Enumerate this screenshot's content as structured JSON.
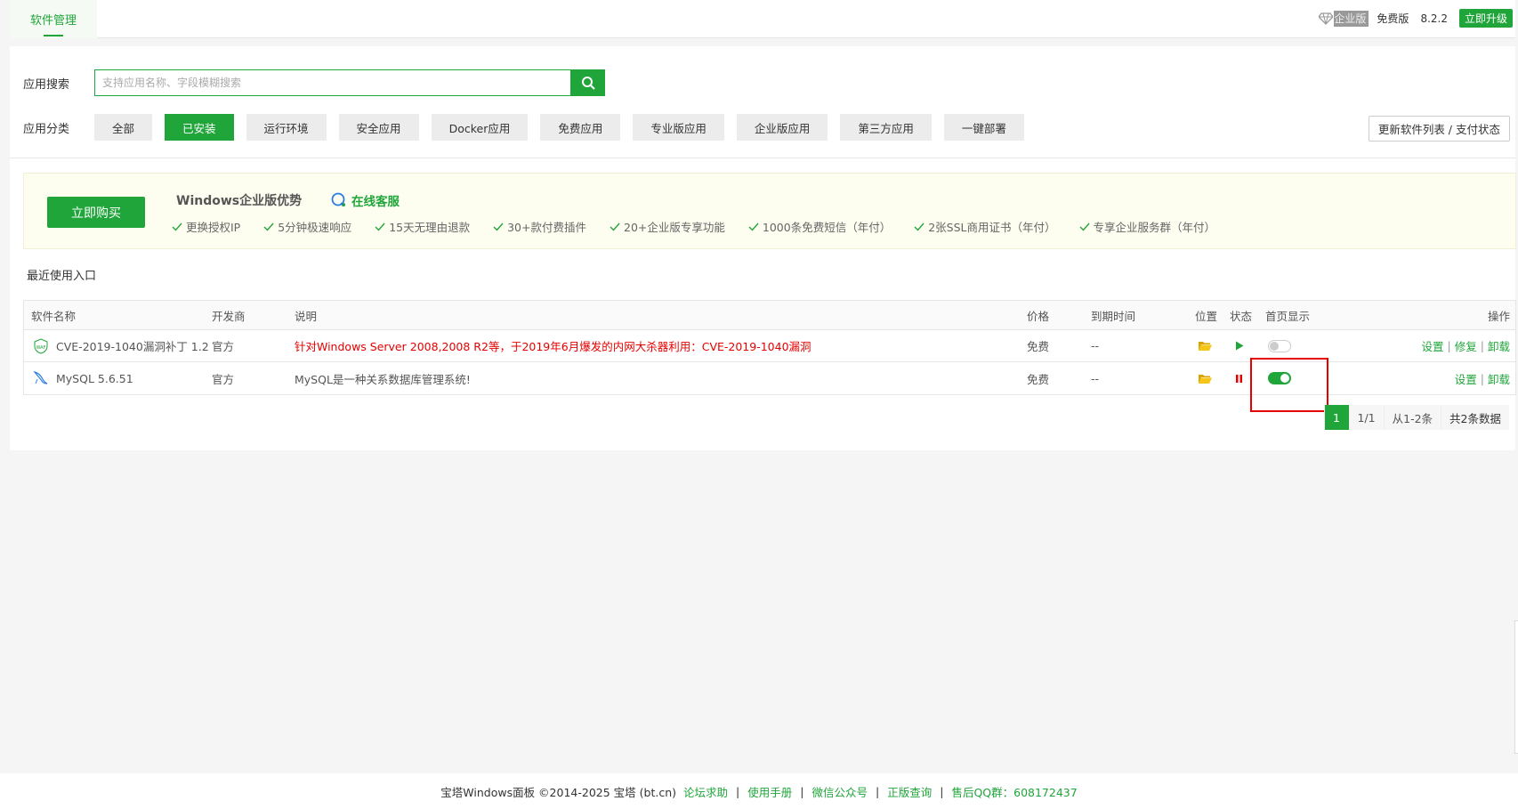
{
  "topbar": {
    "tab": "软件管理",
    "enterprise_label": "企业版",
    "free_label": "免费版",
    "version": "8.2.2",
    "upgrade": "立即升级"
  },
  "search": {
    "label": "应用搜索",
    "placeholder": "支持应用名称、字段模糊搜索"
  },
  "categories": {
    "label": "应用分类",
    "items": [
      "全部",
      "已安装",
      "运行环境",
      "安全应用",
      "Docker应用",
      "免费应用",
      "专业版应用",
      "企业版应用",
      "第三方应用",
      "一键部署"
    ],
    "active_index": 1,
    "refresh": "更新软件列表 / 支付状态"
  },
  "promo": {
    "buy": "立即购买",
    "title": "Windows企业版优势",
    "service": "在线客服",
    "features": [
      "更换授权IP",
      "5分钟极速响应",
      "15天无理由退款",
      "30+款付费插件",
      "20+企业版专享功能",
      "1000条免费短信（年付）",
      "2张SSL商用证书（年付）",
      "专享企业服务群（年付）"
    ]
  },
  "recent_label": "最近使用入口",
  "table": {
    "headers": {
      "name": "软件名称",
      "developer": "开发商",
      "desc": "说明",
      "price": "价格",
      "expire": "到期时间",
      "location": "位置",
      "status": "状态",
      "homepage": "首页显示",
      "ops": "操作"
    },
    "rows": [
      {
        "name": "CVE-2019-1040漏洞补丁 1.2",
        "developer": "官方",
        "desc": "针对Windows Server 2008,2008 R2等，于2019年6月爆发的内网大杀器利用：CVE-2019-1040漏洞",
        "price": "免费",
        "expire": "--",
        "status": "stopped",
        "homepage": false,
        "op_settings": "设置",
        "op_repair": "修复",
        "op_uninstall": "卸载"
      },
      {
        "name": "MySQL 5.6.51",
        "developer": "官方",
        "desc": "MySQL是一种关系数据库管理系统!",
        "price": "免费",
        "expire": "--",
        "status": "running",
        "homepage": true,
        "op_settings": "设置",
        "op_uninstall": "卸载"
      }
    ]
  },
  "pagination": {
    "current": "1",
    "pages": "1/1",
    "range": "从1-2条",
    "total": "共2条数据"
  },
  "footer": {
    "copyright": "宝塔Windows面板 ©2014-2025 宝塔 (bt.cn)",
    "links": [
      "论坛求助",
      "使用手册",
      "微信公众号",
      "正版查询",
      "售后QQ群：608172437"
    ]
  },
  "colors": {
    "accent": "#20a53a",
    "danger": "#e60000",
    "folder": "#f5b400"
  }
}
